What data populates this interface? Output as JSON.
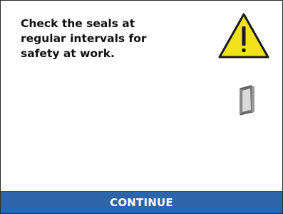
{
  "screen": {
    "message": "Check the seals at\nregular intervals for\nsafety at work."
  },
  "icons": {
    "warning": "warning-triangle-icon",
    "door": "door-seal-icon"
  },
  "colors": {
    "warning_fill": "#f2e21a",
    "warning_outline": "#1a1a1a",
    "continue_bar": "#2e65a8",
    "continue_text": "#ffffff"
  },
  "footer": {
    "continue_label": "CONTINUE"
  }
}
